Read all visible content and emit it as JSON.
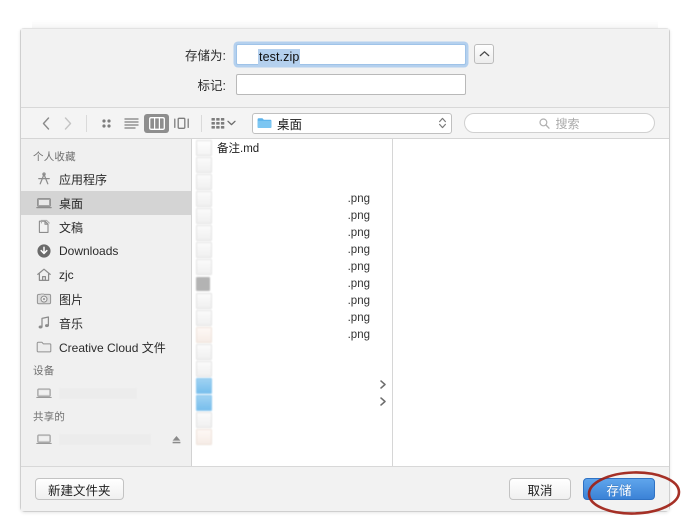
{
  "dialog": {
    "save_as_label": "存储为:",
    "filename_value": "test.zip",
    "tags_label": "标记:",
    "tags_value": "",
    "expand_icon": "chevron-up-icon"
  },
  "toolbar": {
    "back_icon": "chevron-left-icon",
    "forward_icon": "chevron-right-icon",
    "views": [
      {
        "name": "icon-view",
        "icon": "grid-dots-icon",
        "active": false
      },
      {
        "name": "list-view",
        "icon": "list-lines-icon",
        "active": false
      },
      {
        "name": "column-view",
        "icon": "columns-icon",
        "active": true
      },
      {
        "name": "gallery-view",
        "icon": "gallery-icon",
        "active": false
      }
    ],
    "group_icon": "group-grid-icon",
    "group_chevron": "chevron-down-icon",
    "path_label": "桌面",
    "path_icon": "blue-folder-icon",
    "path_stepper_icon": "up-down-stepper-icon",
    "search_placeholder": "搜索",
    "search_icon": "search-icon"
  },
  "sidebar": {
    "sections": [
      {
        "title": "个人收藏",
        "items": [
          {
            "label": "应用程序",
            "icon": "applications-icon",
            "selected": false,
            "redacted": false
          },
          {
            "label": "桌面",
            "icon": "desktop-icon",
            "selected": true,
            "redacted": false
          },
          {
            "label": "文稿",
            "icon": "documents-icon",
            "selected": false,
            "redacted": false
          },
          {
            "label": "Downloads",
            "icon": "downloads-icon",
            "selected": false,
            "redacted": false
          },
          {
            "label": "zjc",
            "icon": "home-icon",
            "selected": false,
            "redacted": false
          },
          {
            "label": "图片",
            "icon": "pictures-icon",
            "selected": false,
            "redacted": false
          },
          {
            "label": "音乐",
            "icon": "music-icon",
            "selected": false,
            "redacted": false
          },
          {
            "label": "Creative Cloud 文件",
            "icon": "folder-icon",
            "selected": false,
            "redacted": false
          }
        ]
      },
      {
        "title": "设备",
        "items": [
          {
            "label": "",
            "icon": "computer-icon",
            "selected": false,
            "redacted": true
          }
        ]
      },
      {
        "title": "共享的",
        "items": [
          {
            "label": "",
            "icon": "computer-icon",
            "selected": false,
            "redacted": true,
            "eject": true
          }
        ]
      }
    ]
  },
  "files": [
    {
      "name": "备注.md",
      "ext": "",
      "icon": "doc",
      "disclose": false
    },
    {
      "name": "",
      "ext": "",
      "icon": "img",
      "disclose": false
    },
    {
      "name": "",
      "ext": "",
      "icon": "img",
      "disclose": false
    },
    {
      "name": "",
      "ext": ".png",
      "icon": "img",
      "disclose": false
    },
    {
      "name": "",
      "ext": ".png",
      "icon": "img",
      "disclose": false
    },
    {
      "name": "",
      "ext": ".png",
      "icon": "img",
      "disclose": false
    },
    {
      "name": "",
      "ext": ".png",
      "icon": "img",
      "disclose": false
    },
    {
      "name": "",
      "ext": ".png",
      "icon": "img",
      "disclose": false
    },
    {
      "name": "",
      "ext": ".png",
      "icon": "dark",
      "disclose": false
    },
    {
      "name": "",
      "ext": ".png",
      "icon": "img",
      "disclose": false
    },
    {
      "name": "",
      "ext": ".png",
      "icon": "img",
      "disclose": false
    },
    {
      "name": "",
      "ext": ".png",
      "icon": "pink",
      "disclose": false
    },
    {
      "name": "",
      "ext": "",
      "icon": "img",
      "disclose": false
    },
    {
      "name": "",
      "ext": "",
      "icon": "img",
      "disclose": false
    },
    {
      "name": "",
      "ext": "",
      "icon": "folder",
      "disclose": true
    },
    {
      "name": "",
      "ext": "",
      "icon": "folder",
      "disclose": true
    },
    {
      "name": "",
      "ext": "",
      "icon": "img",
      "disclose": false
    },
    {
      "name": "",
      "ext": "",
      "icon": "pink",
      "disclose": false
    }
  ],
  "footer": {
    "new_folder_label": "新建文件夹",
    "cancel_label": "取消",
    "save_label": "存储"
  },
  "annotation": {
    "shape": "red-oval-highlight",
    "color": "#9e1f15",
    "target": "save-button"
  }
}
